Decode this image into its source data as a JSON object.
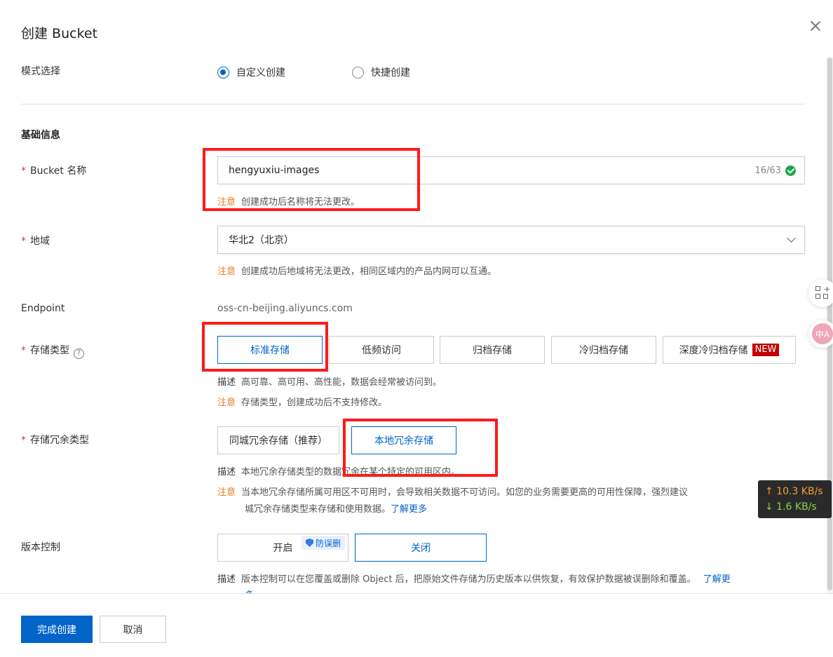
{
  "dialog": {
    "title": "创建 Bucket"
  },
  "mode": {
    "label": "模式选择",
    "options": [
      {
        "label": "自定义创建",
        "selected": true
      },
      {
        "label": "快捷创建",
        "selected": false
      }
    ]
  },
  "basic_section": {
    "title": "基础信息"
  },
  "required_mark": "*",
  "bucket_name": {
    "label": "Bucket 名称",
    "value": "hengyuxiu-images",
    "counter": "16/63",
    "note_tag": "注意",
    "note_text": "创建成功后名称将无法更改。"
  },
  "region": {
    "label": "地域",
    "value": "华北2（北京）",
    "note_tag": "注意",
    "note_text": "创建成功后地域将无法更改，相同区域内的产品内网可以互通。"
  },
  "endpoint": {
    "label": "Endpoint",
    "value": "oss-cn-beijing.aliyuncs.com"
  },
  "storage_class": {
    "label": "存储类型",
    "help": "?",
    "options": [
      {
        "label": "标准存储",
        "selected": true
      },
      {
        "label": "低频访问",
        "selected": false
      },
      {
        "label": "归档存储",
        "selected": false
      },
      {
        "label": "冷归档存储",
        "selected": false
      },
      {
        "label": "深度冷归档存储",
        "selected": false,
        "badge": "NEW"
      }
    ],
    "desc_tag": "描述",
    "desc_text": "高可靠、高可用、高性能，数据会经常被访问到。",
    "note_tag": "注意",
    "note_text": "存储类型，创建成功后不支持修改。"
  },
  "redundancy": {
    "label": "存储冗余类型",
    "options": [
      {
        "label": "同城冗余存储（推荐）",
        "selected": false
      },
      {
        "label": "本地冗余存储",
        "selected": true
      }
    ],
    "desc_tag": "描述",
    "desc_text": "本地冗余存储类型的数据冗余在某个特定的可用区内。",
    "note_tag": "注意",
    "note_text_1": "当本地冗余存储所属可用区不可用时，会导致相关数据不可访问。如您的业务需要更高的可用性保障，强烈建议",
    "note_text_2": "城冗余存储类型来存储和使用数据。",
    "note_link": "了解更多"
  },
  "versioning": {
    "label": "版本控制",
    "options": [
      {
        "label": "开启",
        "selected": false
      },
      {
        "label": "关闭",
        "selected": true
      }
    ],
    "badge": "防误删",
    "desc_tag": "描述",
    "desc_text": "版本控制可以在您覆盖或删除 Object 后，把原始文件存储为历史版本以供恢复，有效保护数据被误删除和覆盖。",
    "desc_link": "了解更",
    "desc_link_tail": "多"
  },
  "footer": {
    "submit_label": "完成创建",
    "cancel_label": "取消"
  },
  "side_float": {
    "translate_label": "中A"
  },
  "netspeed": {
    "up": "↑ 10.3 KB/s",
    "down": "↓ 1.6 KB/s"
  },
  "colors": {
    "primary": "#0064c8",
    "required": "#d9363e",
    "warn": "#e67e22",
    "highlight": "#ff1a1a",
    "new_badge": "#c40000"
  }
}
